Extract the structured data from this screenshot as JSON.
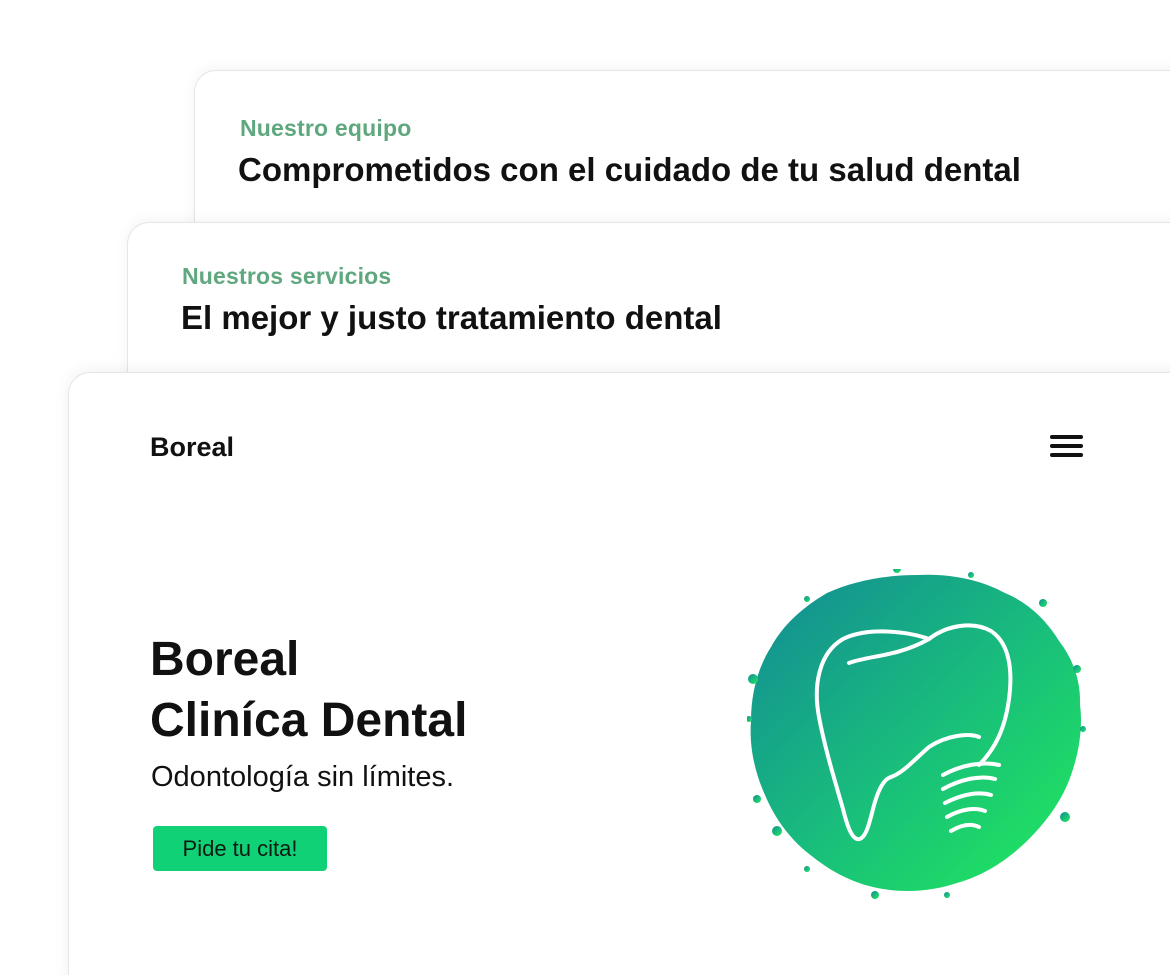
{
  "team_card": {
    "eyebrow": "Nuestro equipo",
    "headline": "Comprometidos con el cuidado de tu salud dental"
  },
  "services_card": {
    "eyebrow": "Nuestros servicios",
    "headline": "El mejor y justo tratamiento dental"
  },
  "header": {
    "brand": "Boreal",
    "menu_icon": "hamburger-menu-icon"
  },
  "hero": {
    "title_line1": "Boreal",
    "title_line2": "Cliníca Dental",
    "subtitle": "Odontología sin límites.",
    "cta_label": "Pide tu cita!",
    "logo_icon": "tooth-logo-icon"
  },
  "colors": {
    "eyebrow": "#5fa77e",
    "cta": "#10d176",
    "logo_gradient_start": "#138a96",
    "logo_gradient_end": "#22ea5a"
  }
}
